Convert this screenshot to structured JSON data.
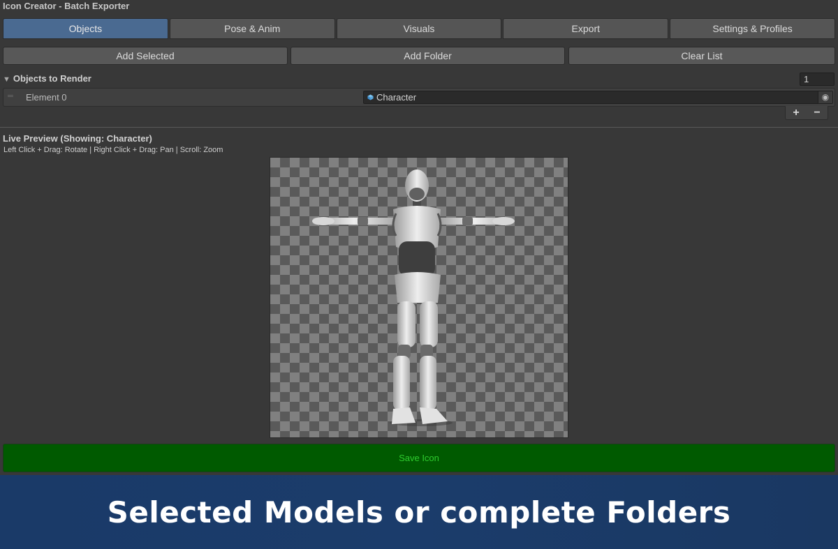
{
  "window": {
    "title": "Icon Creator - Batch Exporter"
  },
  "tabs": [
    {
      "label": "Objects",
      "active": true
    },
    {
      "label": "Pose & Anim",
      "active": false
    },
    {
      "label": "Visuals",
      "active": false
    },
    {
      "label": "Export",
      "active": false
    },
    {
      "label": "Settings & Profiles",
      "active": false
    }
  ],
  "actions": {
    "add_selected": "Add Selected",
    "add_folder": "Add Folder",
    "clear_list": "Clear List"
  },
  "objects_list": {
    "header": "Objects to Render",
    "count": "1",
    "items": [
      {
        "label": "Element 0",
        "value": "Character",
        "icon": "prefab-cube-icon"
      }
    ],
    "add_symbol": "+",
    "remove_symbol": "−"
  },
  "preview": {
    "title": "Live Preview (Showing: Character)",
    "hint": "Left Click + Drag: Rotate | Right Click + Drag: Pan | Scroll: Zoom"
  },
  "save_button": {
    "label": "Save Icon"
  },
  "banner": {
    "text": "Selected Models or complete Folders"
  },
  "colors": {
    "accent_tab": "#4a6a91",
    "save_bg": "#005a00",
    "save_text": "#2ecc2e",
    "banner_bg": "#1b3c6b"
  }
}
